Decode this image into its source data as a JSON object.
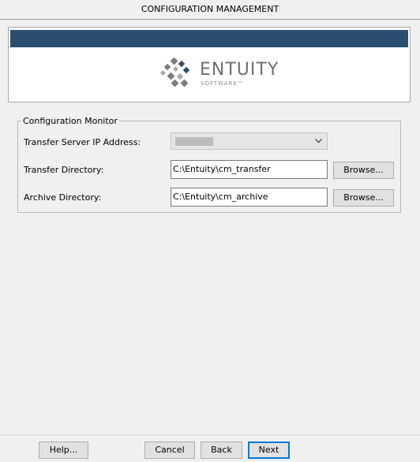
{
  "window": {
    "title": "CONFIGURATION MANAGEMENT"
  },
  "logo": {
    "brand": "ENTUITY",
    "tagline": "SOFTWARE™"
  },
  "config_monitor": {
    "group_title": "Configuration Monitor",
    "ip_label": "Transfer Server IP Address:",
    "transfer_label": "Transfer Directory:",
    "transfer_value": "C:\\Entuity\\cm_transfer",
    "transfer_browse": "Browse...",
    "archive_label": "Archive Directory:",
    "archive_value": "C:\\Entuity\\cm_archive",
    "archive_browse": "Browse..."
  },
  "footer": {
    "help": "Help...",
    "cancel": "Cancel",
    "back": "Back",
    "next": "Next"
  },
  "colors": {
    "banner_stripe": "#2b4d6f",
    "default_button_border": "#0078d7"
  }
}
